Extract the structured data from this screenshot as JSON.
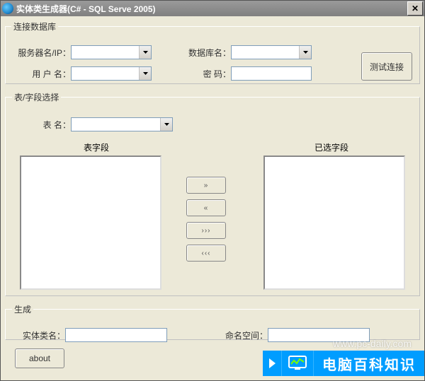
{
  "window": {
    "title": "实体类生成器(C# - SQL Serve 2005)",
    "close_glyph": "✕"
  },
  "connection": {
    "legend": "连接数据库",
    "server_label": "服务器名/IP：",
    "database_label": "数据库名：",
    "user_label": "用 户 名：",
    "password_label": "密  码：",
    "server_value": "",
    "database_value": "",
    "user_value": "",
    "password_value": "",
    "test_button": "测试连接"
  },
  "tables": {
    "legend": "表/字段选择",
    "table_label": "表   名：",
    "table_value": "",
    "left_header": "表字段",
    "right_header": "已选字段",
    "left_items": [],
    "right_items": [],
    "move_all_right": "»",
    "move_one_left": "«",
    "move_one_right_alt": "›››",
    "move_all_left_alt": "‹‹‹"
  },
  "generate": {
    "legend": "生成",
    "entity_label": "实体类名：",
    "namespace_label": "命名空间：",
    "entity_value": "",
    "namespace_value": ""
  },
  "footer": {
    "about_button": "about"
  },
  "watermark": "www.pc-daily.com",
  "badge_text": "电脑百科知识"
}
